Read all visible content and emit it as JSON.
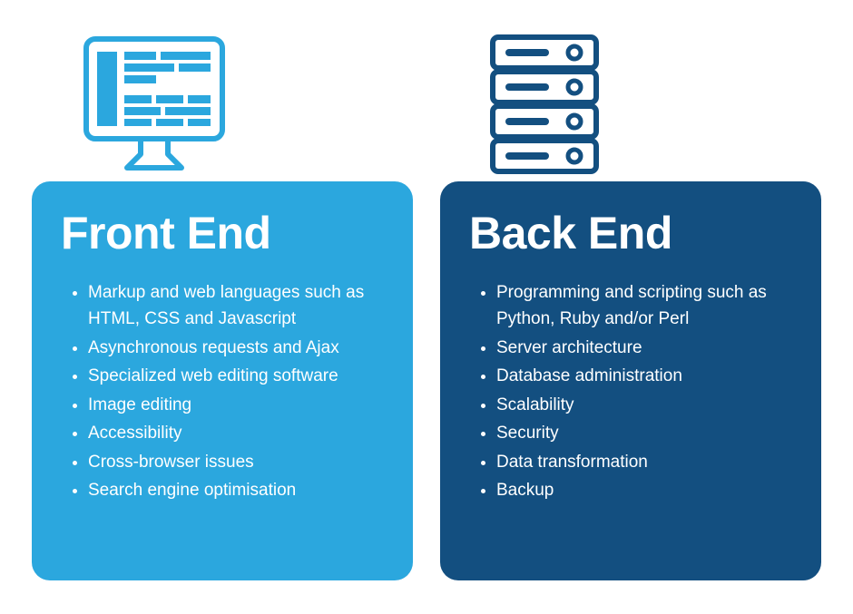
{
  "front": {
    "title": "Front End",
    "color": "#2ba7de",
    "icon": "monitor-icon",
    "items": [
      "Markup and web languages such as HTML, CSS and Javascript",
      "Asynchronous requests and Ajax",
      "Specialized web editing software",
      "Image editing",
      "Accessibility",
      "Cross-browser issues",
      "Search engine optimisation"
    ]
  },
  "back": {
    "title": "Back End",
    "color": "#134f80",
    "icon": "server-icon",
    "items": [
      "Programming and scripting such as Python, Ruby and/or Perl",
      "Server architecture",
      "Database administration",
      "Scalability",
      "Security",
      "Data transformation",
      "Backup"
    ]
  }
}
